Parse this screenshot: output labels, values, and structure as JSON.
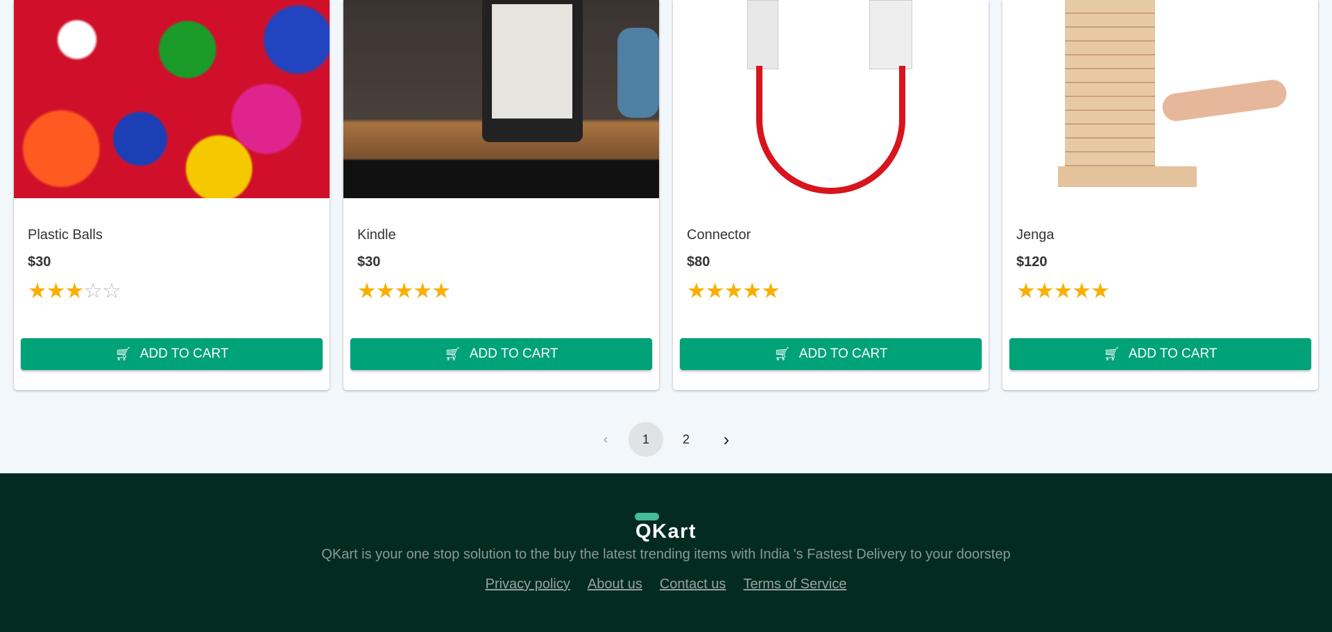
{
  "products": [
    {
      "name": "Plastic Balls",
      "price": "$30",
      "rating": 3,
      "add_label": "ADD TO CART"
    },
    {
      "name": "Kindle",
      "price": "$30",
      "rating": 5,
      "add_label": "ADD TO CART"
    },
    {
      "name": "Connector",
      "price": "$80",
      "rating": 5,
      "add_label": "ADD TO CART"
    },
    {
      "name": "Jenga",
      "price": "$120",
      "rating": 5,
      "add_label": "ADD TO CART"
    }
  ],
  "pagination": {
    "pages": [
      "1",
      "2"
    ],
    "current": "1",
    "prev_icon": "chevron-left-icon",
    "next_icon": "chevron-right-icon"
  },
  "footer": {
    "logo": "QKart",
    "tagline": "QKart is your one stop solution to the buy the latest trending items with India 's Fastest Delivery to your doorstep",
    "links": [
      "Privacy policy",
      "About us",
      "Contact us",
      "Terms of Service"
    ]
  },
  "colors": {
    "accent": "#00a278",
    "footer_bg": "#032b22",
    "star": "#faaf00",
    "logo_bar": "#44bd99"
  }
}
